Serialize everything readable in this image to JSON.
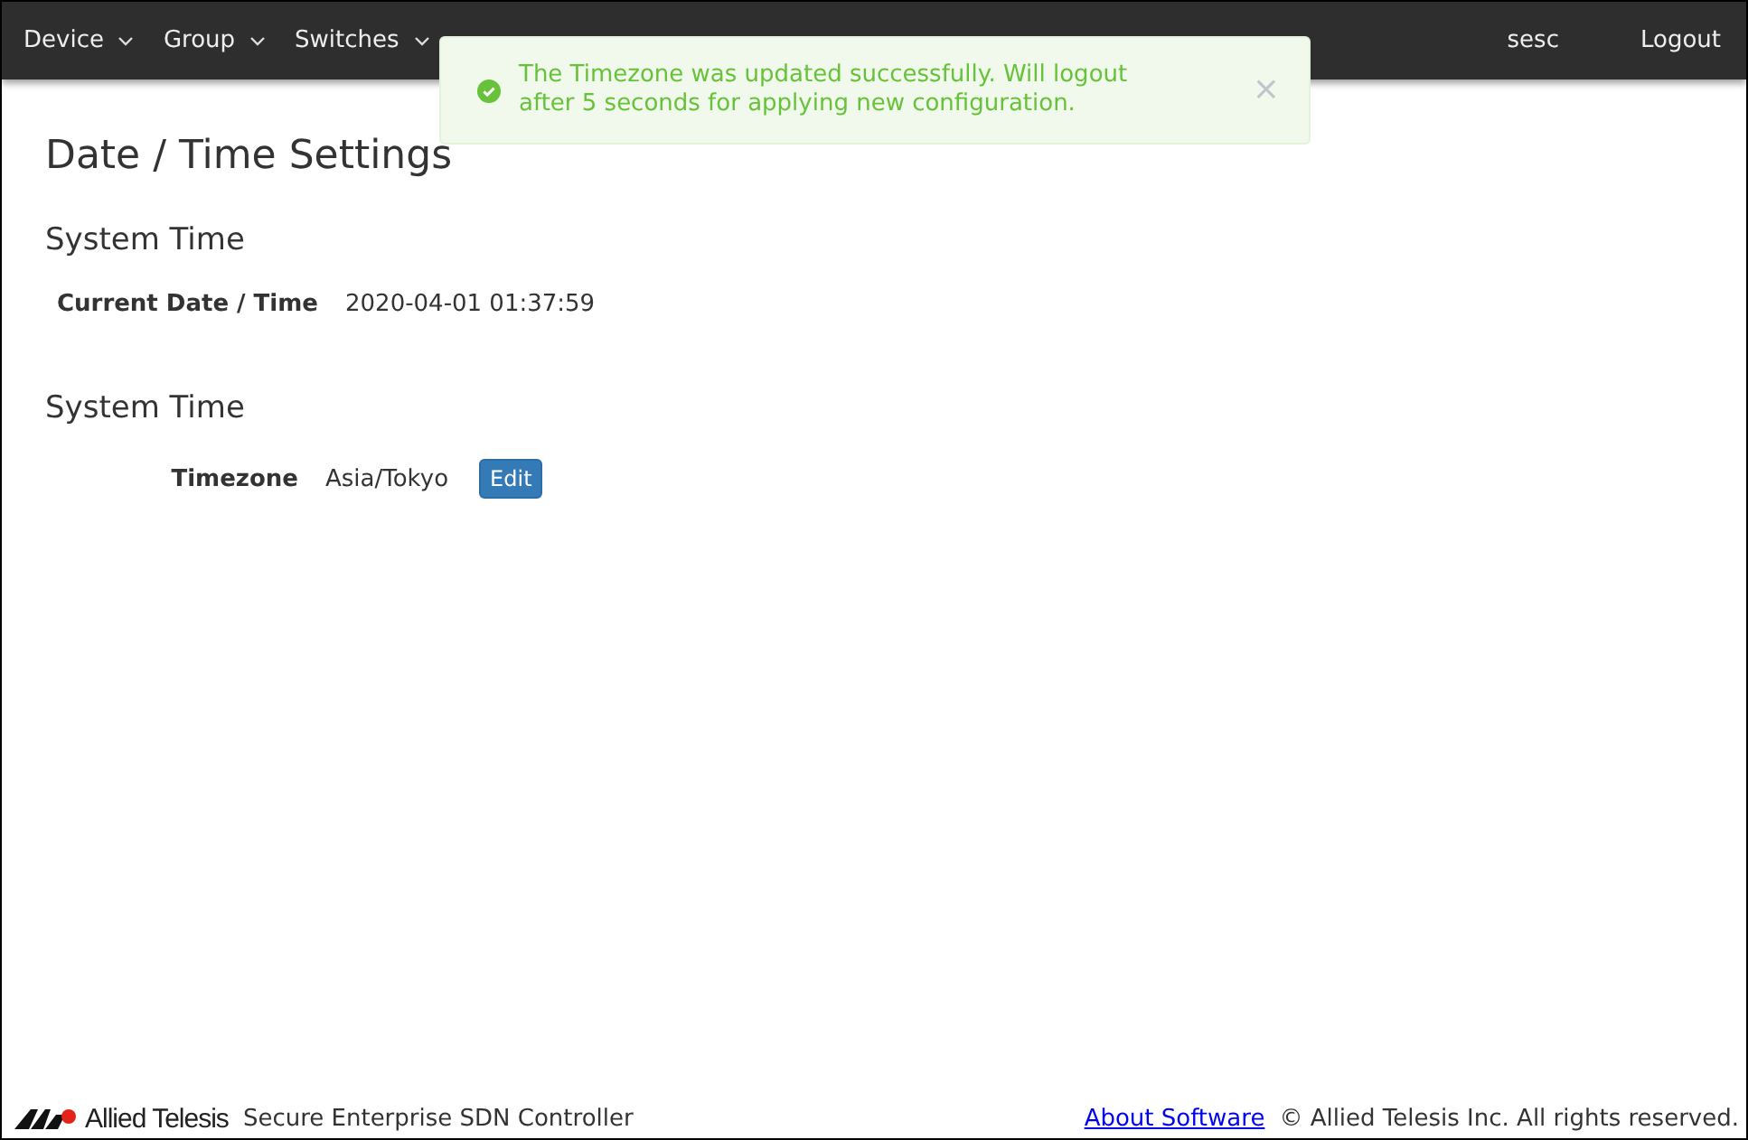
{
  "navbar": {
    "menus": [
      {
        "label": "Device",
        "dropdown": true
      },
      {
        "label": "Group",
        "dropdown": true
      },
      {
        "label": "Switches",
        "dropdown": true
      }
    ],
    "user": "sesc",
    "logout": "Logout"
  },
  "toast": {
    "message": "The Timezone was updated successfully. Will logout after 5 seconds for applying new configuration.",
    "close": "×"
  },
  "page_title": "Date / Time Settings",
  "sections": [
    {
      "title": "System Time",
      "label": "Current Date / Time",
      "value": "2020-04-01 01:37:59"
    },
    {
      "title": "System Time",
      "label": "Timezone",
      "value": "Asia/Tokyo",
      "button": "Edit"
    }
  ],
  "footer": {
    "logo": "Allied Telesis",
    "product": "Secure Enterprise SDN Controller",
    "link": "About Software",
    "copyright": "© Allied Telesis Inc. All rights reserved."
  }
}
